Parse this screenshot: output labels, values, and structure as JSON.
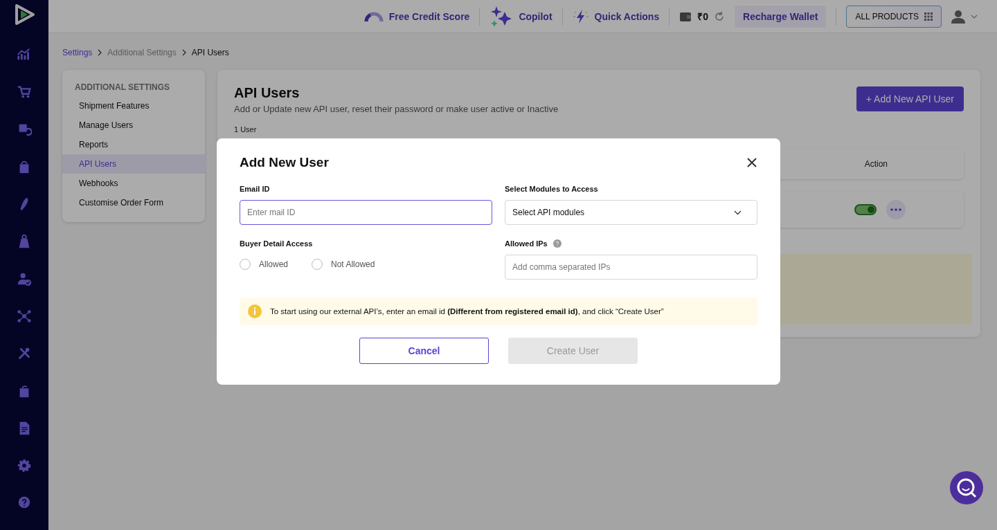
{
  "topbar": {
    "credit_score": "Free Credit Score",
    "copilot": "Copilot",
    "quick_actions": "Quick Actions",
    "wallet_balance": "₹0",
    "recharge": "Recharge Wallet",
    "all_products": "ALL PRODUCTS"
  },
  "breadcrumb": [
    "Settings",
    "Additional Settings",
    "API Users"
  ],
  "settings_menu": {
    "heading": "ADDITIONAL SETTINGS",
    "items": [
      {
        "label": "Shipment Features",
        "selected": false
      },
      {
        "label": "Manage Users",
        "selected": false
      },
      {
        "label": "Reports",
        "selected": false
      },
      {
        "label": "API Users",
        "selected": true
      },
      {
        "label": "Webhooks",
        "selected": false
      },
      {
        "label": "Customise Order Form",
        "selected": false
      }
    ]
  },
  "page": {
    "title": "API Users",
    "subtitle": "Add or Update new API user, reset their password or make user active or Inactive",
    "add_button": "+ Add New API User",
    "count": "1 User",
    "table": {
      "columns": [
        "Action"
      ],
      "rows": [
        {
          "active": true
        }
      ]
    }
  },
  "modal": {
    "title": "Add New User",
    "email": {
      "label": "Email ID",
      "placeholder": "Enter mail ID",
      "focused": true
    },
    "modules": {
      "label": "Select Modules to Access",
      "placeholder": "Select API modules"
    },
    "buyer_access": {
      "label": "Buyer Detail Access",
      "options": [
        {
          "label": "Allowed",
          "selected": false
        },
        {
          "label": "Not Allowed",
          "selected": false
        }
      ]
    },
    "allowed_ips": {
      "label": "Allowed IPs",
      "placeholder": "Add comma separated IPs"
    },
    "notice": "To start using our external API’s, enter an email id **(Different from registered email id)**, and click “Create User”",
    "buttons": [
      {
        "label": "Cancel",
        "kind": "secondary",
        "disabled": false
      },
      {
        "label": "Create User",
        "kind": "primary",
        "disabled": true
      }
    ]
  }
}
